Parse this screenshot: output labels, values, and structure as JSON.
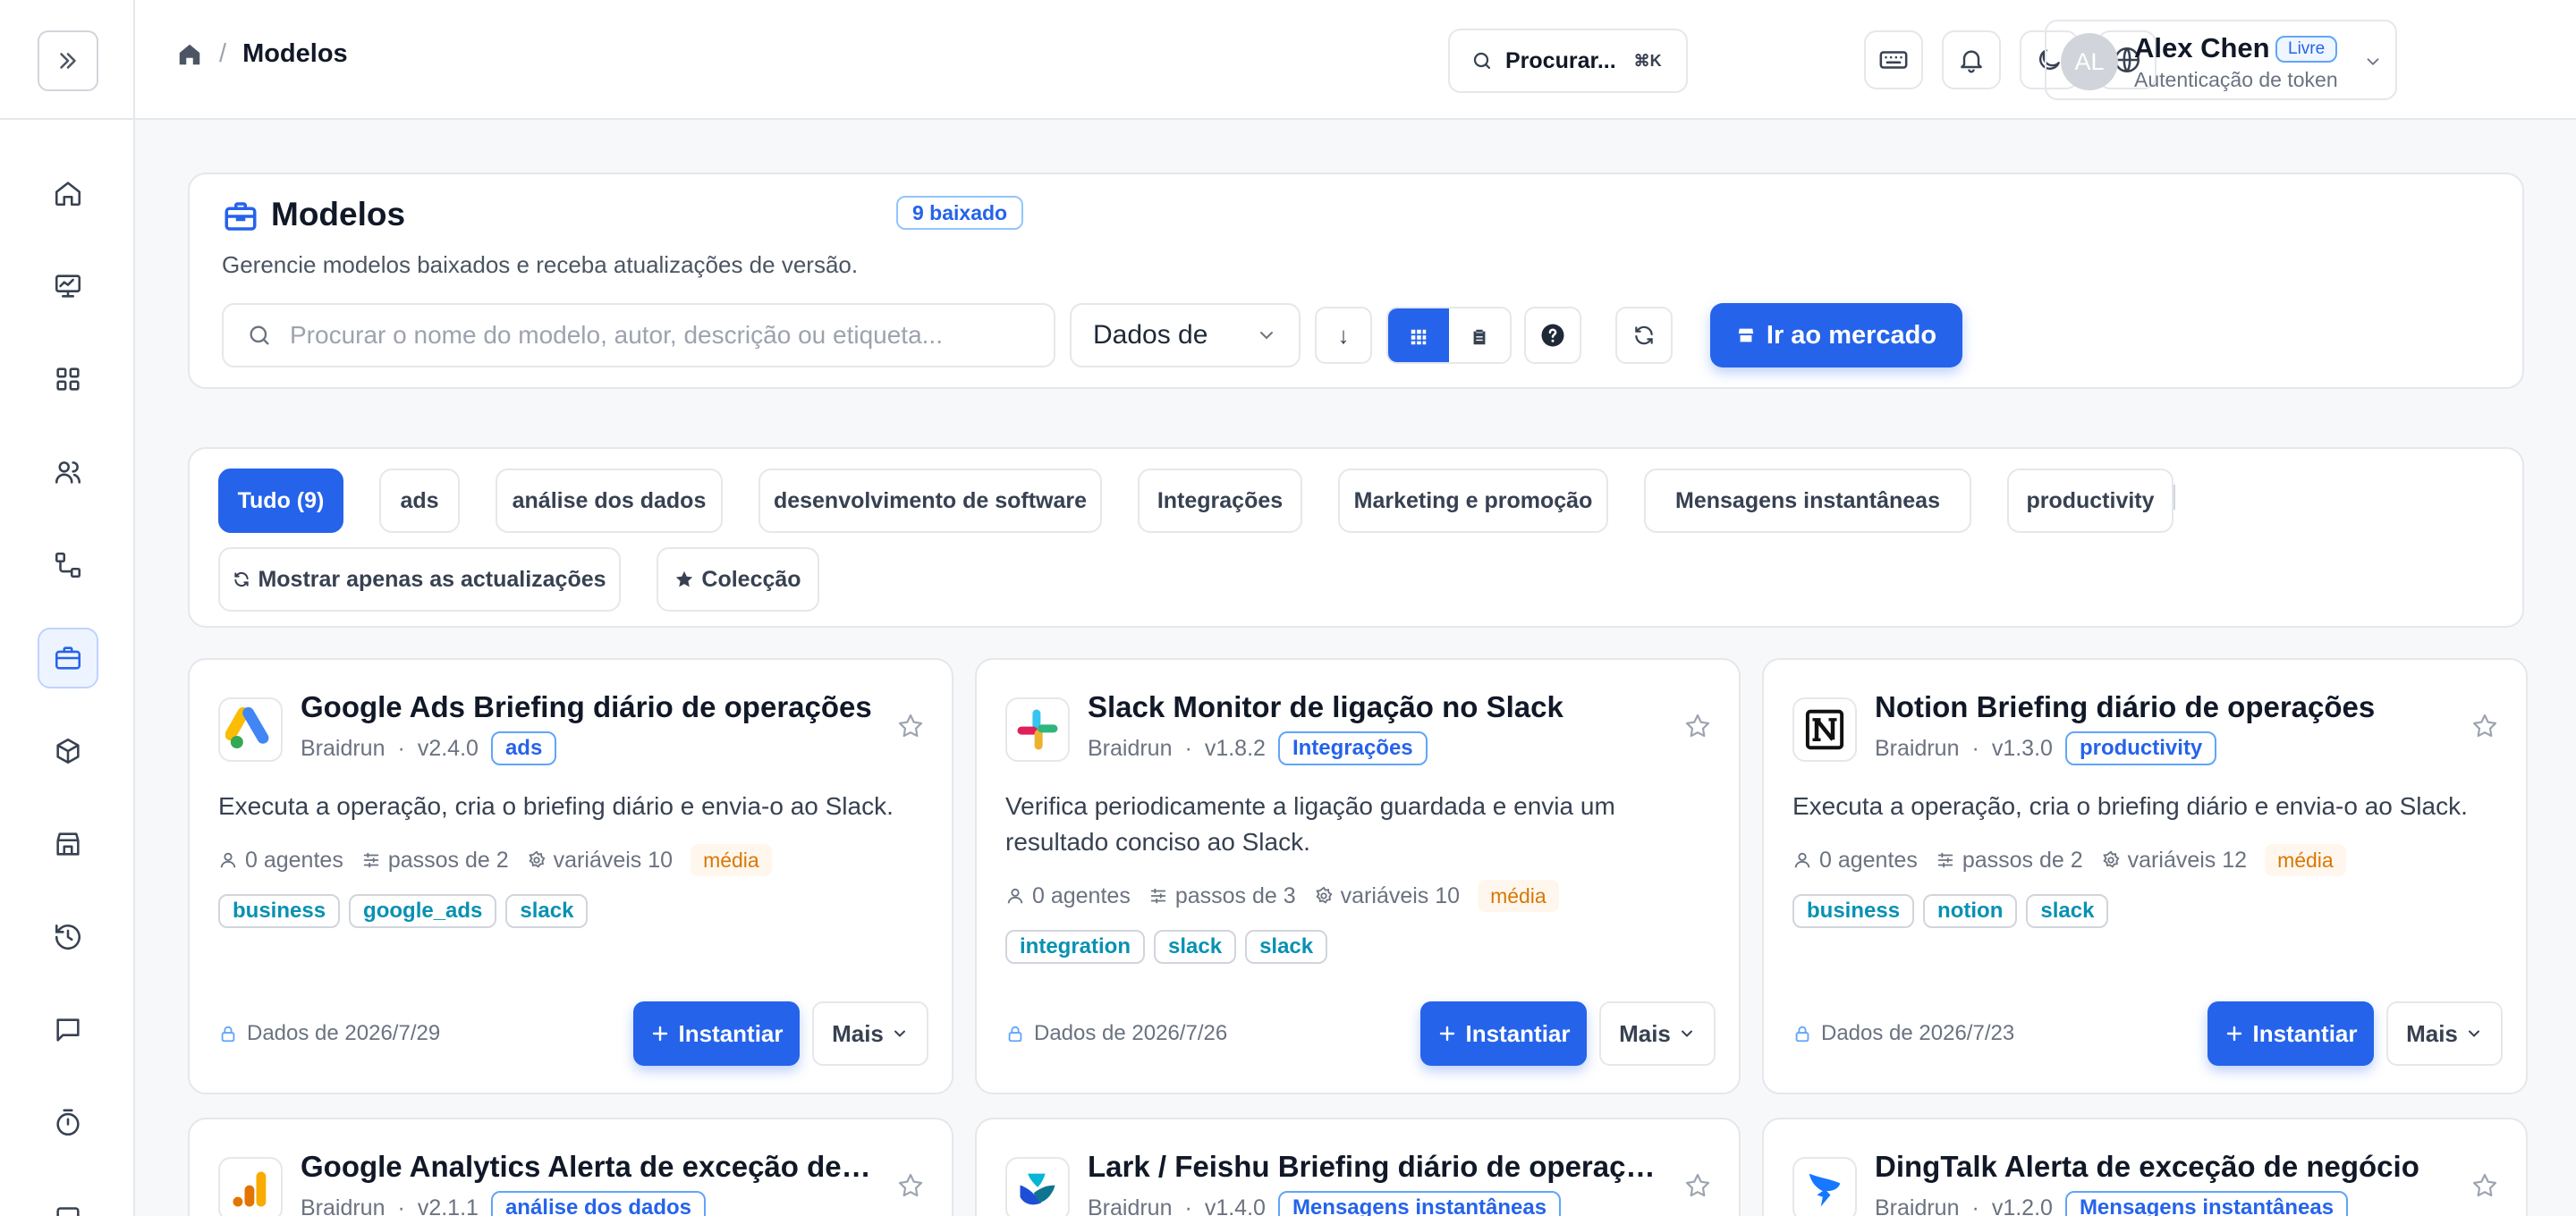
{
  "header": {
    "breadcrumb_current": "Modelos",
    "search_label": "Procurar...",
    "search_shortcut": "⌘K",
    "user": {
      "initials": "AL",
      "name": "Alex Chen",
      "plan": "Livre",
      "subtitle": "Autenticação de token"
    }
  },
  "panel": {
    "title": "Modelos",
    "count_badge": "9 baixado",
    "description": "Gerencie modelos baixados e receba atualizações de versão.",
    "search_placeholder": "Procurar o nome do modelo, autor, descrição ou etiqueta...",
    "sort_select": "Dados de",
    "sort_dir": "↓",
    "market_button": "Ir ao mercado"
  },
  "filters": {
    "chips": [
      "Tudo (9)",
      "ads",
      "análise dos dados",
      "desenvolvimento de software",
      "Integrações",
      "Marketing e promoção",
      "Mensagens instantâneas",
      "productivity"
    ],
    "updates_only": "Mostrar apenas as actualizações",
    "collection": "Colecção"
  },
  "templates": [
    {
      "title": "Google Ads Briefing diário de operações",
      "author": "Braidrun",
      "version": "v2.4.0",
      "category": "ads",
      "description": "Executa a operação, cria o briefing diário e envia-o ao Slack.",
      "agents": "0 agentes",
      "steps": "passos de 2",
      "variables": "variáveis 10",
      "level": "média",
      "tags": [
        "business",
        "google_ads",
        "slack"
      ],
      "date": "Dados de 2026/7/29",
      "instantiate": "Instantiar",
      "more": "Mais"
    },
    {
      "title": "Slack Monitor de ligação no Slack",
      "author": "Braidrun",
      "version": "v1.8.2",
      "category": "Integrações",
      "description": "Verifica periodicamente a ligação guardada e envia um resultado conciso ao Slack.",
      "agents": "0 agentes",
      "steps": "passos de 3",
      "variables": "variáveis 10",
      "level": "média",
      "tags": [
        "integration",
        "slack",
        "slack"
      ],
      "date": "Dados de 2026/7/26",
      "instantiate": "Instantiar",
      "more": "Mais"
    },
    {
      "title": "Notion Briefing diário de operações",
      "author": "Braidrun",
      "version": "v1.3.0",
      "category": "productivity",
      "description": "Executa a operação, cria o briefing diário e envia-o ao Slack.",
      "agents": "0 agentes",
      "steps": "passos de 2",
      "variables": "variáveis 12",
      "level": "média",
      "tags": [
        "business",
        "notion",
        "slack"
      ],
      "date": "Dados de 2026/7/23",
      "instantiate": "Instantiar",
      "more": "Mais"
    },
    {
      "title": "Google Analytics Alerta de exceção de negócio",
      "author": "Braidrun",
      "version": "v2.1.1",
      "category": "análise dos dados"
    },
    {
      "title": "Lark / Feishu Briefing diário de operações",
      "author": "Braidrun",
      "version": "v1.4.0",
      "category": "Mensagens instantâneas"
    },
    {
      "title": "DingTalk Alerta de exceção de negócio",
      "author": "Braidrun",
      "version": "v1.2.0",
      "category": "Mensagens instantâneas"
    }
  ],
  "colors": {
    "accent": "#2563eb",
    "level_text": "#d97706",
    "tag_text": "#0891b2"
  }
}
